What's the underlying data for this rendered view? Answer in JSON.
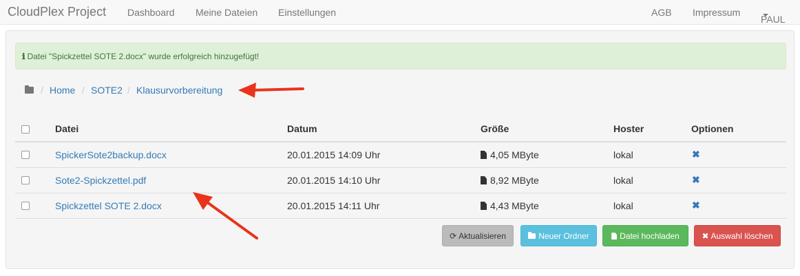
{
  "navbar": {
    "brand": "CloudPlex Project",
    "left_links": [
      "Dashboard",
      "Meine Dateien",
      "Einstellungen"
    ],
    "right_links": [
      "AGB",
      "Impressum"
    ],
    "user": "PAUL"
  },
  "alert": {
    "icon": "info-icon",
    "message": "Datei \"Spickzettel SOTE 2.docx\" wurde erfolgreich hinzugefügt!"
  },
  "breadcrumb": {
    "icon": "folder-icon",
    "separator": "/",
    "items": [
      "Home",
      "SOTE2",
      "Klausurvorbereitung"
    ]
  },
  "table": {
    "headers": [
      "Datei",
      "Datum",
      "Größe",
      "Hoster",
      "Optionen"
    ],
    "rows": [
      {
        "name": "SpickerSote2backup.docx",
        "date": "20.01.2015 14:09 Uhr",
        "size": "4,05 MByte",
        "hoster": "lokal"
      },
      {
        "name": "Sote2-Spickzettel.pdf",
        "date": "20.01.2015 14:10 Uhr",
        "size": "8,92 MByte",
        "hoster": "lokal"
      },
      {
        "name": "Spickzettel SOTE 2.docx",
        "date": "20.01.2015 14:11 Uhr",
        "size": "4,43 MByte",
        "hoster": "lokal"
      }
    ]
  },
  "buttons": {
    "refresh": "Aktualisieren",
    "new_folder": "Neuer Ordner",
    "upload": "Datei hochladen",
    "delete_selection": "Auswahl löschen"
  },
  "colors": {
    "link": "#337ab7",
    "alert_bg": "#dff0d8",
    "alert_text": "#3c763d",
    "btn_info": "#5bc0de",
    "btn_success": "#5cb85c",
    "btn_danger": "#d9534f",
    "annotation_arrow": "#e8341c"
  }
}
